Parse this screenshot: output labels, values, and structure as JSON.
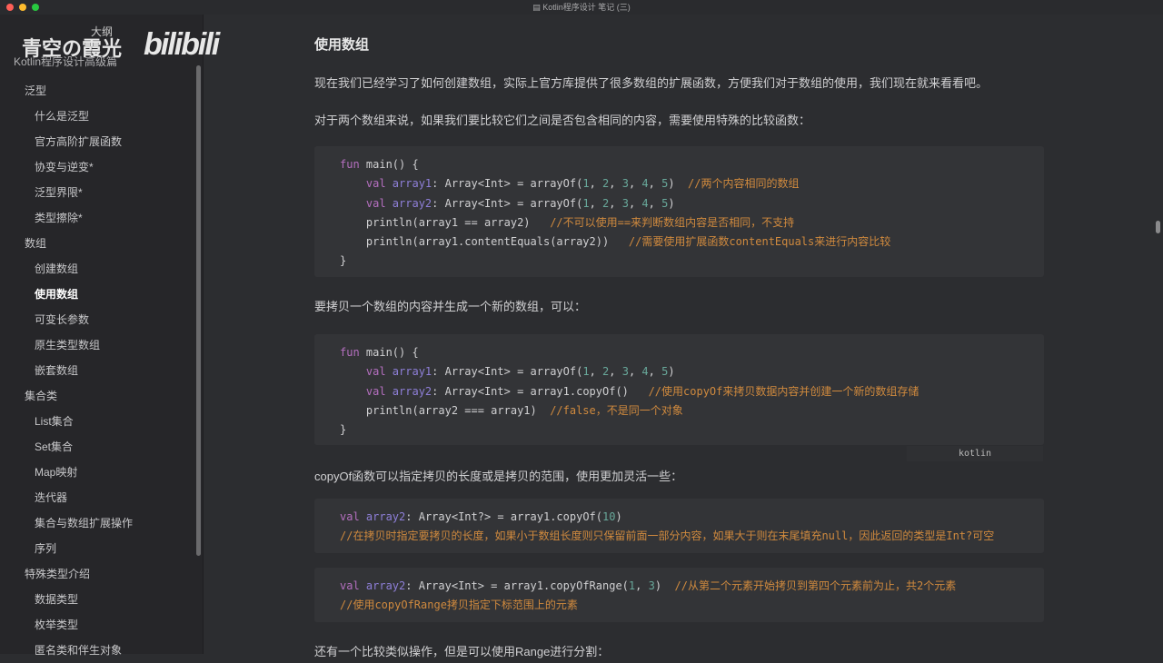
{
  "window": {
    "title": "Kotlin程序设计 笔记 (三)"
  },
  "watermark": {
    "name": "青空の霞光",
    "brand": "bilibili",
    "outline_label": "大纲"
  },
  "sidebar": {
    "title": "Kotlin程序设计高级篇",
    "items": [
      {
        "label": "泛型",
        "level": 1
      },
      {
        "label": "什么是泛型",
        "level": 2
      },
      {
        "label": "官方高阶扩展函数",
        "level": 2
      },
      {
        "label": "协变与逆变*",
        "level": 2
      },
      {
        "label": "泛型界限*",
        "level": 2
      },
      {
        "label": "类型擦除*",
        "level": 2
      },
      {
        "label": "数组",
        "level": 1
      },
      {
        "label": "创建数组",
        "level": 2
      },
      {
        "label": "使用数组",
        "level": 2,
        "active": true
      },
      {
        "label": "可变长参数",
        "level": 2
      },
      {
        "label": "原生类型数组",
        "level": 2
      },
      {
        "label": "嵌套数组",
        "level": 2
      },
      {
        "label": "集合类",
        "level": 1
      },
      {
        "label": "List集合",
        "level": 2
      },
      {
        "label": "Set集合",
        "level": 2
      },
      {
        "label": "Map映射",
        "level": 2
      },
      {
        "label": "迭代器",
        "level": 2
      },
      {
        "label": "集合与数组扩展操作",
        "level": 2
      },
      {
        "label": "序列",
        "level": 2
      },
      {
        "label": "特殊类型介绍",
        "level": 1
      },
      {
        "label": "数据类型",
        "level": 2
      },
      {
        "label": "枚举类型",
        "level": 2
      },
      {
        "label": "匿名类和伴生对象",
        "level": 2
      }
    ]
  },
  "main": {
    "heading": "使用数组",
    "p1": "现在我们已经学习了如何创建数组，实际上官方库提供了很多数组的扩展函数，方便我们对于数组的使用，我们现在就来看看吧。",
    "p2": "对于两个数组来说，如果我们要比较它们之间是否包含相同的内容，需要使用特殊的比较函数：",
    "p3": "要拷贝一个数组的内容并生成一个新的数组，可以：",
    "p4": "copyOf函数可以指定拷贝的长度或是拷贝的范围，使用更加灵活一些：",
    "p5": "还有一个比较类似操作，但是可以使用Range进行分割：",
    "lang_label": "kotlin",
    "code_blocks": [
      [
        [
          [
            "kw",
            "fun "
          ],
          [
            "tx",
            "main() {"
          ]
        ],
        [
          [
            "kw",
            "    val "
          ],
          [
            "vn",
            "array1"
          ],
          [
            "tx",
            ": Array<Int> = arrayOf("
          ],
          [
            "nm",
            "1"
          ],
          [
            "tx",
            ", "
          ],
          [
            "nm",
            "2"
          ],
          [
            "tx",
            ", "
          ],
          [
            "nm",
            "3"
          ],
          [
            "tx",
            ", "
          ],
          [
            "nm",
            "4"
          ],
          [
            "tx",
            ", "
          ],
          [
            "nm",
            "5"
          ],
          [
            "tx",
            ")  "
          ],
          [
            "cm",
            "//两个内容相同的数组"
          ]
        ],
        [
          [
            "kw",
            "    val "
          ],
          [
            "vn",
            "array2"
          ],
          [
            "tx",
            ": Array<Int> = arrayOf("
          ],
          [
            "nm",
            "1"
          ],
          [
            "tx",
            ", "
          ],
          [
            "nm",
            "2"
          ],
          [
            "tx",
            ", "
          ],
          [
            "nm",
            "3"
          ],
          [
            "tx",
            ", "
          ],
          [
            "nm",
            "4"
          ],
          [
            "tx",
            ", "
          ],
          [
            "nm",
            "5"
          ],
          [
            "tx",
            ")"
          ]
        ],
        [
          [
            "tx",
            "    println(array1 == array2)   "
          ],
          [
            "cm",
            "//不可以使用==来判断数组内容是否相同，不支持"
          ]
        ],
        [
          [
            "tx",
            "    println(array1.contentEquals(array2))   "
          ],
          [
            "cm",
            "//需要使用扩展函数contentEquals来进行内容比较"
          ]
        ],
        [
          [
            "tx",
            "}"
          ]
        ]
      ],
      [
        [
          [
            "kw",
            "fun "
          ],
          [
            "tx",
            "main() {"
          ]
        ],
        [
          [
            "kw",
            "    val "
          ],
          [
            "vn",
            "array1"
          ],
          [
            "tx",
            ": Array<Int> = arrayOf("
          ],
          [
            "nm",
            "1"
          ],
          [
            "tx",
            ", "
          ],
          [
            "nm",
            "2"
          ],
          [
            "tx",
            ", "
          ],
          [
            "nm",
            "3"
          ],
          [
            "tx",
            ", "
          ],
          [
            "nm",
            "4"
          ],
          [
            "tx",
            ", "
          ],
          [
            "nm",
            "5"
          ],
          [
            "tx",
            ")"
          ]
        ],
        [
          [
            "kw",
            "    val "
          ],
          [
            "vn",
            "array2"
          ],
          [
            "tx",
            ": Array<Int> = array1.copyOf()   "
          ],
          [
            "cm",
            "//使用copyOf来拷贝数据内容并创建一个新的数组存储"
          ]
        ],
        [
          [
            "tx",
            "    println(array2 === array1)  "
          ],
          [
            "cm",
            "//false，不是同一个对象"
          ]
        ],
        [
          [
            "tx",
            "}"
          ]
        ]
      ],
      [
        [
          [
            "kw",
            "val "
          ],
          [
            "vn",
            "array2"
          ],
          [
            "tx",
            ": Array<Int?> = array1.copyOf("
          ],
          [
            "nm",
            "10"
          ],
          [
            "tx",
            ")"
          ]
        ],
        [
          [
            "cm",
            "//在拷贝时指定要拷贝的长度，如果小于数组长度则只保留前面一部分内容，如果大于则在末尾填充null，因此返回的类型是Int?可空"
          ]
        ]
      ],
      [
        [
          [
            "kw",
            "val "
          ],
          [
            "vn",
            "array2"
          ],
          [
            "tx",
            ": Array<Int> = array1.copyOfRange("
          ],
          [
            "nm",
            "1"
          ],
          [
            "tx",
            ", "
          ],
          [
            "nm",
            "3"
          ],
          [
            "tx",
            ")  "
          ],
          [
            "cm",
            "//从第二个元素开始拷贝到第四个元素前为止，共2个元素"
          ]
        ],
        [
          [
            "cm",
            "//使用copyOfRange拷贝指定下标范围上的元素"
          ]
        ]
      ]
    ]
  }
}
